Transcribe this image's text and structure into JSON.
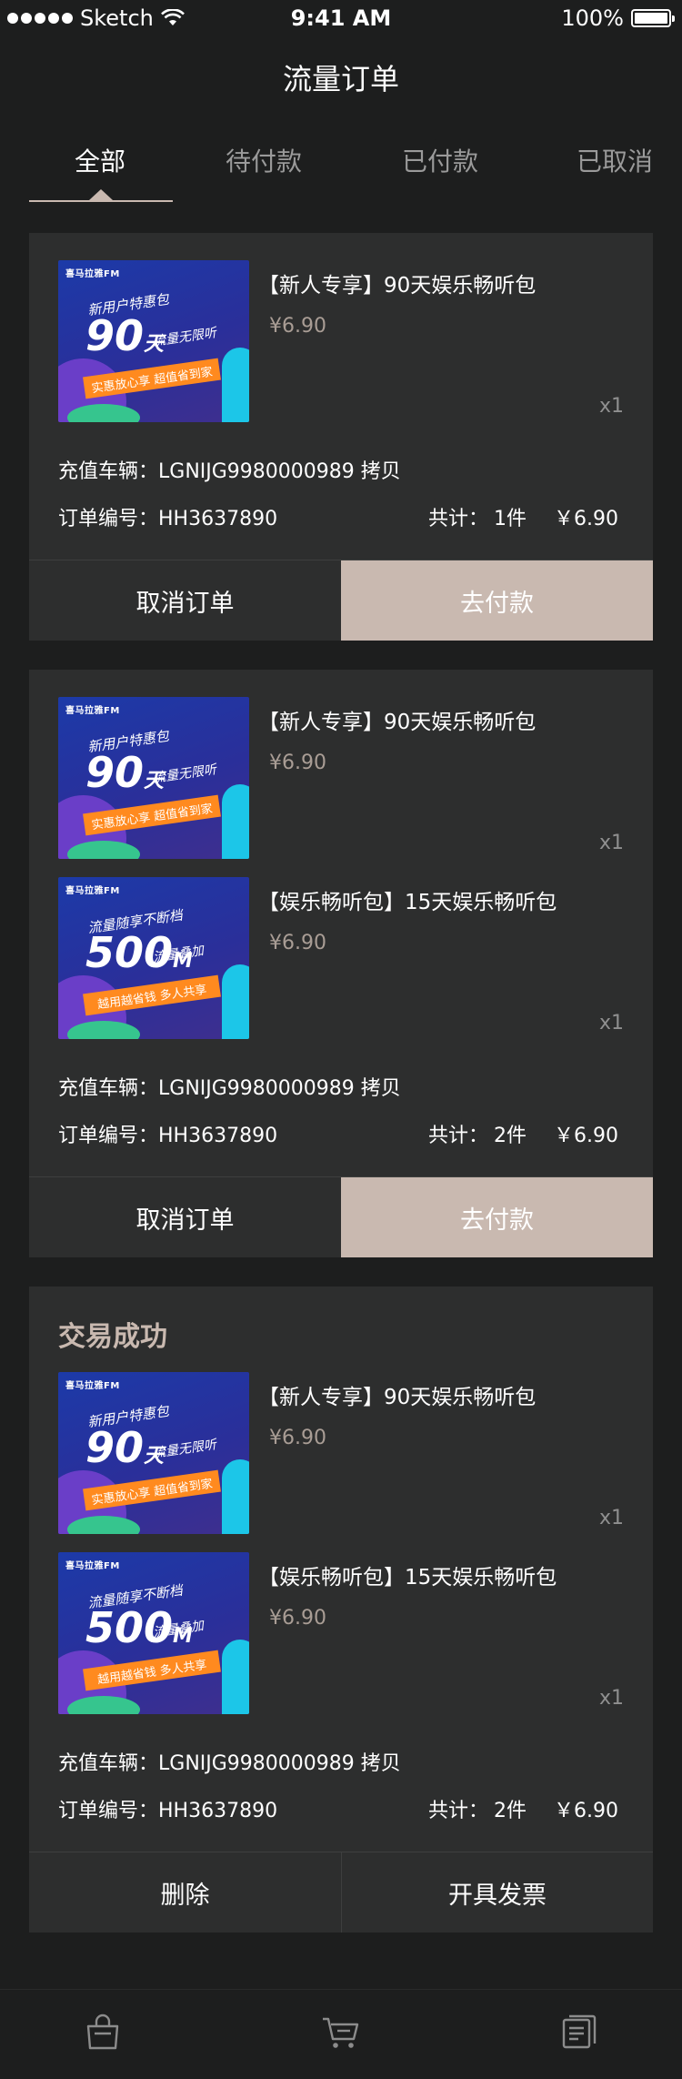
{
  "status_bar": {
    "carrier": "Sketch",
    "time": "9:41 AM",
    "battery": "100%"
  },
  "nav": {
    "title": "流量订单"
  },
  "tabs": [
    {
      "label": "全部",
      "active": true
    },
    {
      "label": "待付款"
    },
    {
      "label": "已付款"
    },
    {
      "label": "已取消"
    }
  ],
  "orders": [
    {
      "items": [
        {
          "title": "【新人专享】90天娱乐畅听包",
          "price": "¥6.90",
          "qty": "x1",
          "thumb": {
            "logo": "喜马拉雅FM",
            "tagline": "新用户特惠包",
            "big": "90",
            "unit": "天",
            "sub": "流量无限听",
            "ribbon": "实惠放心享 超值省到家"
          }
        }
      ],
      "vehicle_label": "充值车辆：",
      "vehicle": "LGNIJG9980000989 拷贝",
      "order_label": "订单编号：",
      "order_no": "HH3637890",
      "total_label": "共计：",
      "count": "1件",
      "amount": "￥6.90",
      "left_btn": "取消订单",
      "right_btn": "去付款"
    },
    {
      "items": [
        {
          "title": "【新人专享】90天娱乐畅听包",
          "price": "¥6.90",
          "qty": "x1",
          "thumb": {
            "logo": "喜马拉雅FM",
            "tagline": "新用户特惠包",
            "big": "90",
            "unit": "天",
            "sub": "流量无限听",
            "ribbon": "实惠放心享 超值省到家"
          }
        },
        {
          "title": "【娱乐畅听包】15天娱乐畅听包",
          "price": "¥6.90",
          "qty": "x1",
          "thumb": {
            "logo": "喜马拉雅FM",
            "tagline": "流量随享不断档",
            "big": "500",
            "unit": "M",
            "sub": "流量叠加",
            "ribbon": "越用越省钱 多人共享"
          }
        }
      ],
      "vehicle_label": "充值车辆：",
      "vehicle": "LGNIJG9980000989 拷贝",
      "order_label": "订单编号：",
      "order_no": "HH3637890",
      "total_label": "共计：",
      "count": "2件",
      "amount": "￥6.90",
      "left_btn": "取消订单",
      "right_btn": "去付款"
    },
    {
      "status": "交易成功",
      "items": [
        {
          "title": "【新人专享】90天娱乐畅听包",
          "price": "¥6.90",
          "qty": "x1",
          "thumb": {
            "logo": "喜马拉雅FM",
            "tagline": "新用户特惠包",
            "big": "90",
            "unit": "天",
            "sub": "流量无限听",
            "ribbon": "实惠放心享 超值省到家"
          }
        },
        {
          "title": "【娱乐畅听包】15天娱乐畅听包",
          "price": "¥6.90",
          "qty": "x1",
          "thumb": {
            "logo": "喜马拉雅FM",
            "tagline": "流量随享不断档",
            "big": "500",
            "unit": "M",
            "sub": "流量叠加",
            "ribbon": "越用越省钱 多人共享"
          }
        }
      ],
      "vehicle_label": "充值车辆：",
      "vehicle": "LGNIJG9980000989 拷贝",
      "order_label": "订单编号：",
      "order_no": "HH3637890",
      "total_label": "共计：",
      "count": "2件",
      "amount": "￥6.90",
      "left_btn": "删除",
      "right_btn": "开具发票"
    }
  ],
  "tabbar": [
    {
      "icon": "shopping-bag-icon"
    },
    {
      "icon": "cart-icon"
    },
    {
      "icon": "orders-list-icon"
    }
  ],
  "colors": {
    "accent": "#c9b9b0",
    "card": "#2d2e2e",
    "background": "#1d1e1e",
    "price": "#a99d95"
  }
}
